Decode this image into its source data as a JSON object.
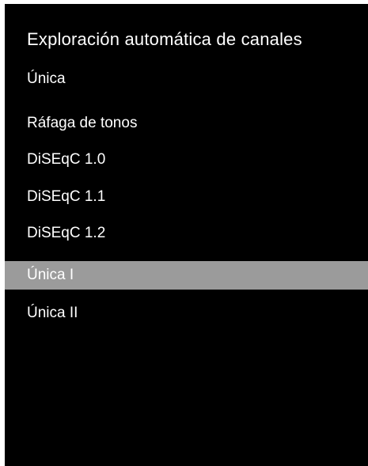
{
  "menu": {
    "title": "Exploración automática de canales",
    "subtitle": "Única",
    "items": [
      {
        "label": "Ráfaga de tonos",
        "selected": false
      },
      {
        "label": "DiSEqC 1.0",
        "selected": false
      },
      {
        "label": "DiSEqC 1.1",
        "selected": false
      },
      {
        "label": "DiSEqC 1.2",
        "selected": false
      },
      {
        "label": "Única I",
        "selected": true
      },
      {
        "label": "Única II",
        "selected": false
      }
    ]
  },
  "colors": {
    "background": "#000000",
    "text": "#ffffff",
    "selection": "#9b9b9b"
  }
}
